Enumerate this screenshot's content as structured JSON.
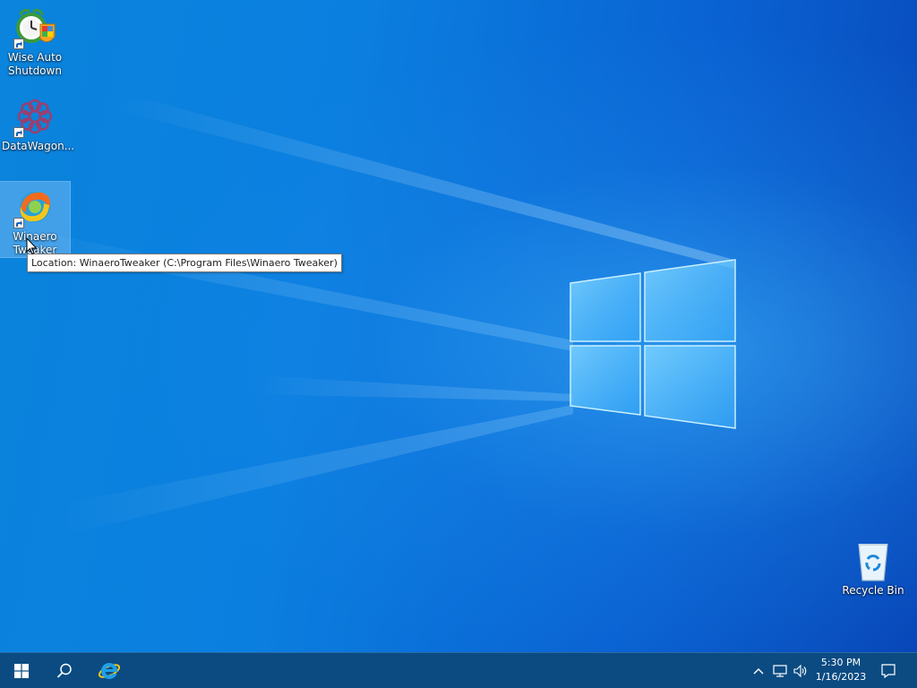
{
  "desktop": {
    "icons": [
      {
        "name": "wise-auto-shutdown",
        "label_line1": "Wise Auto",
        "label_line2": "Shutdown",
        "icon": "alarm-clock-shield-icon"
      },
      {
        "name": "datawagon",
        "label_line1": "DataWagon...",
        "label_line2": "",
        "icon": "gear-flower-icon"
      },
      {
        "name": "winaero-tweaker",
        "label_line1": "Winaero",
        "label_line2": "Tweaker",
        "icon": "swirl-logo-icon",
        "selected": true
      },
      {
        "name": "recycle-bin",
        "label_line1": "Recycle Bin",
        "label_line2": "",
        "icon": "recycle-bin-icon"
      }
    ],
    "tooltip": "Location: WinaeroTweaker (C:\\Program Files\\Winaero Tweaker)"
  },
  "taskbar": {
    "start_icon": "windows-logo-icon",
    "search_icon": "search-icon",
    "pinned": [
      {
        "name": "internet-explorer",
        "icon": "internet-explorer-icon"
      }
    ],
    "tray": {
      "icons": [
        "chevron-up-icon",
        "network-icon",
        "volume-icon"
      ],
      "time": "5:30 PM",
      "date": "1/16/2023",
      "notification_icon": "notification-icon"
    }
  },
  "colors": {
    "taskbar": "#0b4b82",
    "desktop_accent": "#0a84dc"
  }
}
